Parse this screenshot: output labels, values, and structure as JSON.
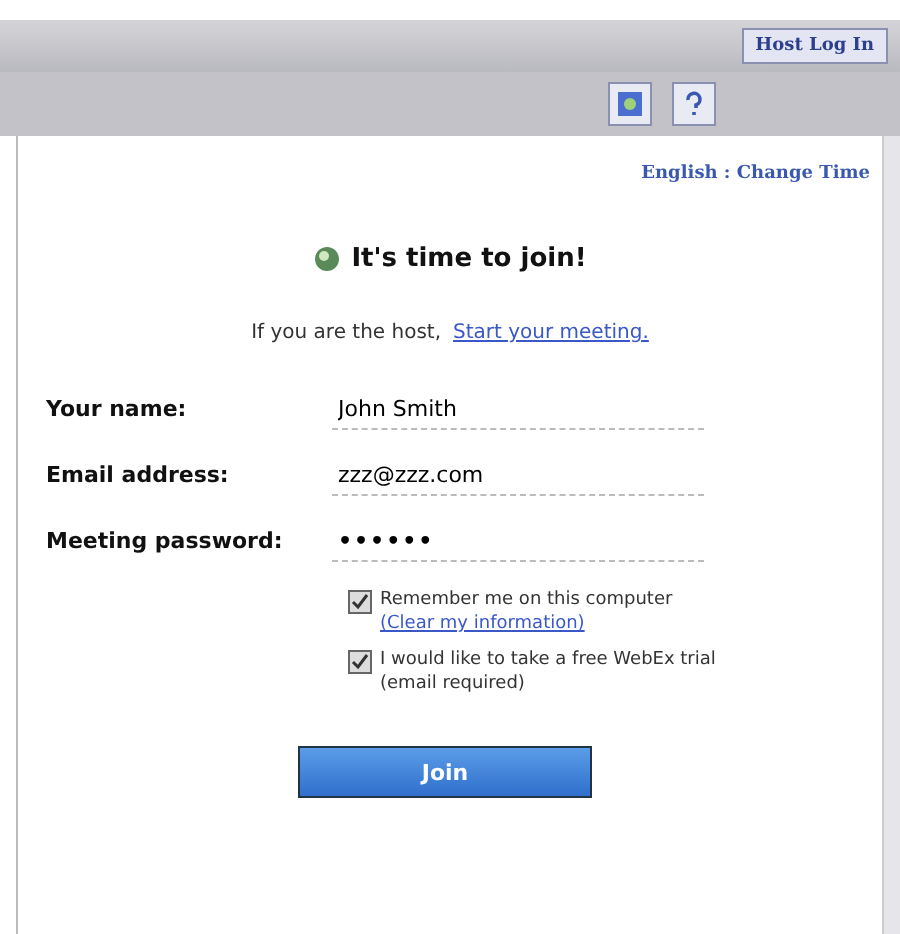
{
  "header": {
    "login_button": "Host Log In"
  },
  "toolbar": {
    "links": "English : Change Time"
  },
  "title": "It's time to join!",
  "host_line": {
    "text": "If you are the host,",
    "link": "Start your meeting."
  },
  "fields": [
    {
      "label": "Your name:",
      "value": "John Smith",
      "kind": "text"
    },
    {
      "label": "Email address:",
      "value": "zzz@zzz.com",
      "kind": "text"
    },
    {
      "label": "Meeting password:",
      "value": "••••••",
      "kind": "password"
    }
  ],
  "options": [
    {
      "label": "Remember me on this computer",
      "link": "(Clear my information)",
      "checked": true,
      "kind": "link"
    },
    {
      "label": "I would like to take a free WebEx trial",
      "link": "(email required)",
      "checked": true,
      "kind": "note"
    }
  ],
  "join_button": "Join"
}
